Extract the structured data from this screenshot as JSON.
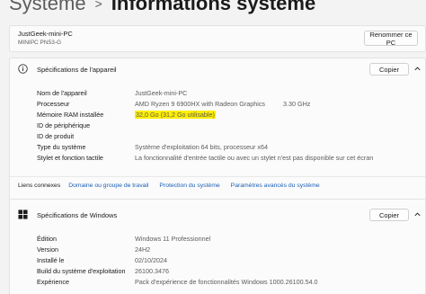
{
  "breadcrumb": {
    "parent": "Système",
    "separator": ">",
    "current": "Informations système"
  },
  "pc": {
    "name": "JustGeek-mini-PC",
    "model": "MINIPC PN53-G",
    "rename_label": "Renommer ce PC"
  },
  "device_specs": {
    "title": "Spécifications de l'appareil",
    "copy_label": "Copier",
    "rows": [
      {
        "label": "Nom de l'appareil",
        "value": "JustGeek-mini-PC"
      },
      {
        "label": "Processeur",
        "value": "AMD Ryzen 9 6900HX with Radeon Graphics",
        "value2": "3.30 GHz"
      },
      {
        "label": "Mémoire RAM installée",
        "value": "32,0 Go (31,2 Go utilisable)"
      },
      {
        "label": "ID de périphérique",
        "value": ""
      },
      {
        "label": "ID de produit",
        "value": ""
      },
      {
        "label": "Type du système",
        "value": "Système d'exploitation 64 bits, processeur x64"
      },
      {
        "label": "Stylet et fonction tactile",
        "value": "La fonctionnalité d'entrée tactile ou avec un stylet n'est pas disponible sur cet écran"
      }
    ]
  },
  "related_links": {
    "label": "Liens connexes",
    "links": [
      "Domaine ou groupe de travail",
      "Protection du système",
      "Paramètres avancés du système"
    ]
  },
  "windows_specs": {
    "title": "Spécifications de Windows",
    "copy_label": "Copier",
    "rows": [
      {
        "label": "Édition",
        "value": "Windows 11 Professionnel"
      },
      {
        "label": "Version",
        "value": "24H2"
      },
      {
        "label": "Installé le",
        "value": "02/10/2024"
      },
      {
        "label": "Build du système d'exploitation",
        "value": "26100.3476"
      },
      {
        "label": "Expérience",
        "value": "Pack d'expérience de fonctionnalités Windows 1000.26100.54.0"
      }
    ]
  },
  "colors": {
    "highlight": "#ffef00",
    "link": "#1a5fb4",
    "windows_logo": "#1b1b1b"
  },
  "icons": {
    "device_specs": "info-icon",
    "windows_specs": "windows-logo-icon",
    "collapse": "chevron-up-icon"
  }
}
